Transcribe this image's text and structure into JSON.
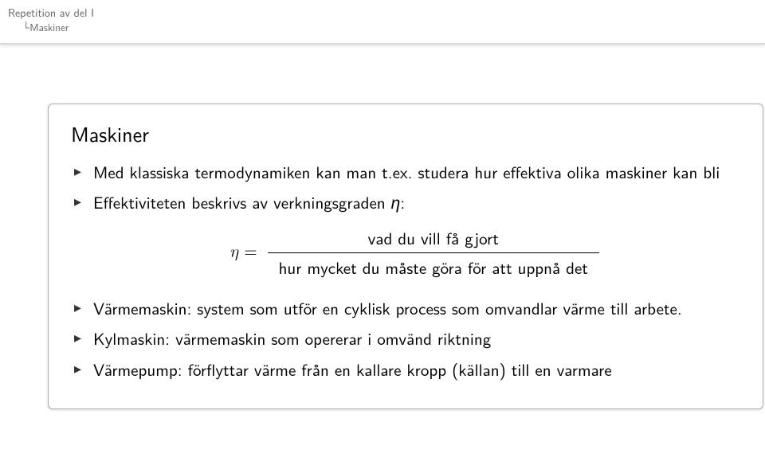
{
  "header": {
    "line1": "Repetition av del I",
    "line2": "Maskiner"
  },
  "block": {
    "title": "Maskiner",
    "bullet1a": "Med klassiska termodynamiken kan man t.ex. studera hur effektiva olika maskiner kan bli",
    "bullet2": "Effektiviteten beskrivs av verkningsgraden ",
    "bullet2_sym": "η",
    "bullet2_colon": ":",
    "eq": {
      "lhs": "η",
      "eq": " = ",
      "num": "vad du vill få gjort",
      "den": "hur mycket du måste göra för att uppnå det"
    },
    "bullet3": "Värmemaskin: system som utför en cyklisk process som omvandlar värme till arbete.",
    "bullet4": "Kylmaskin: värmemaskin som opererar i omvänd riktning",
    "bullet5": "Värmepump: förflyttar värme från en kallare kropp (källan) till en varmare"
  }
}
